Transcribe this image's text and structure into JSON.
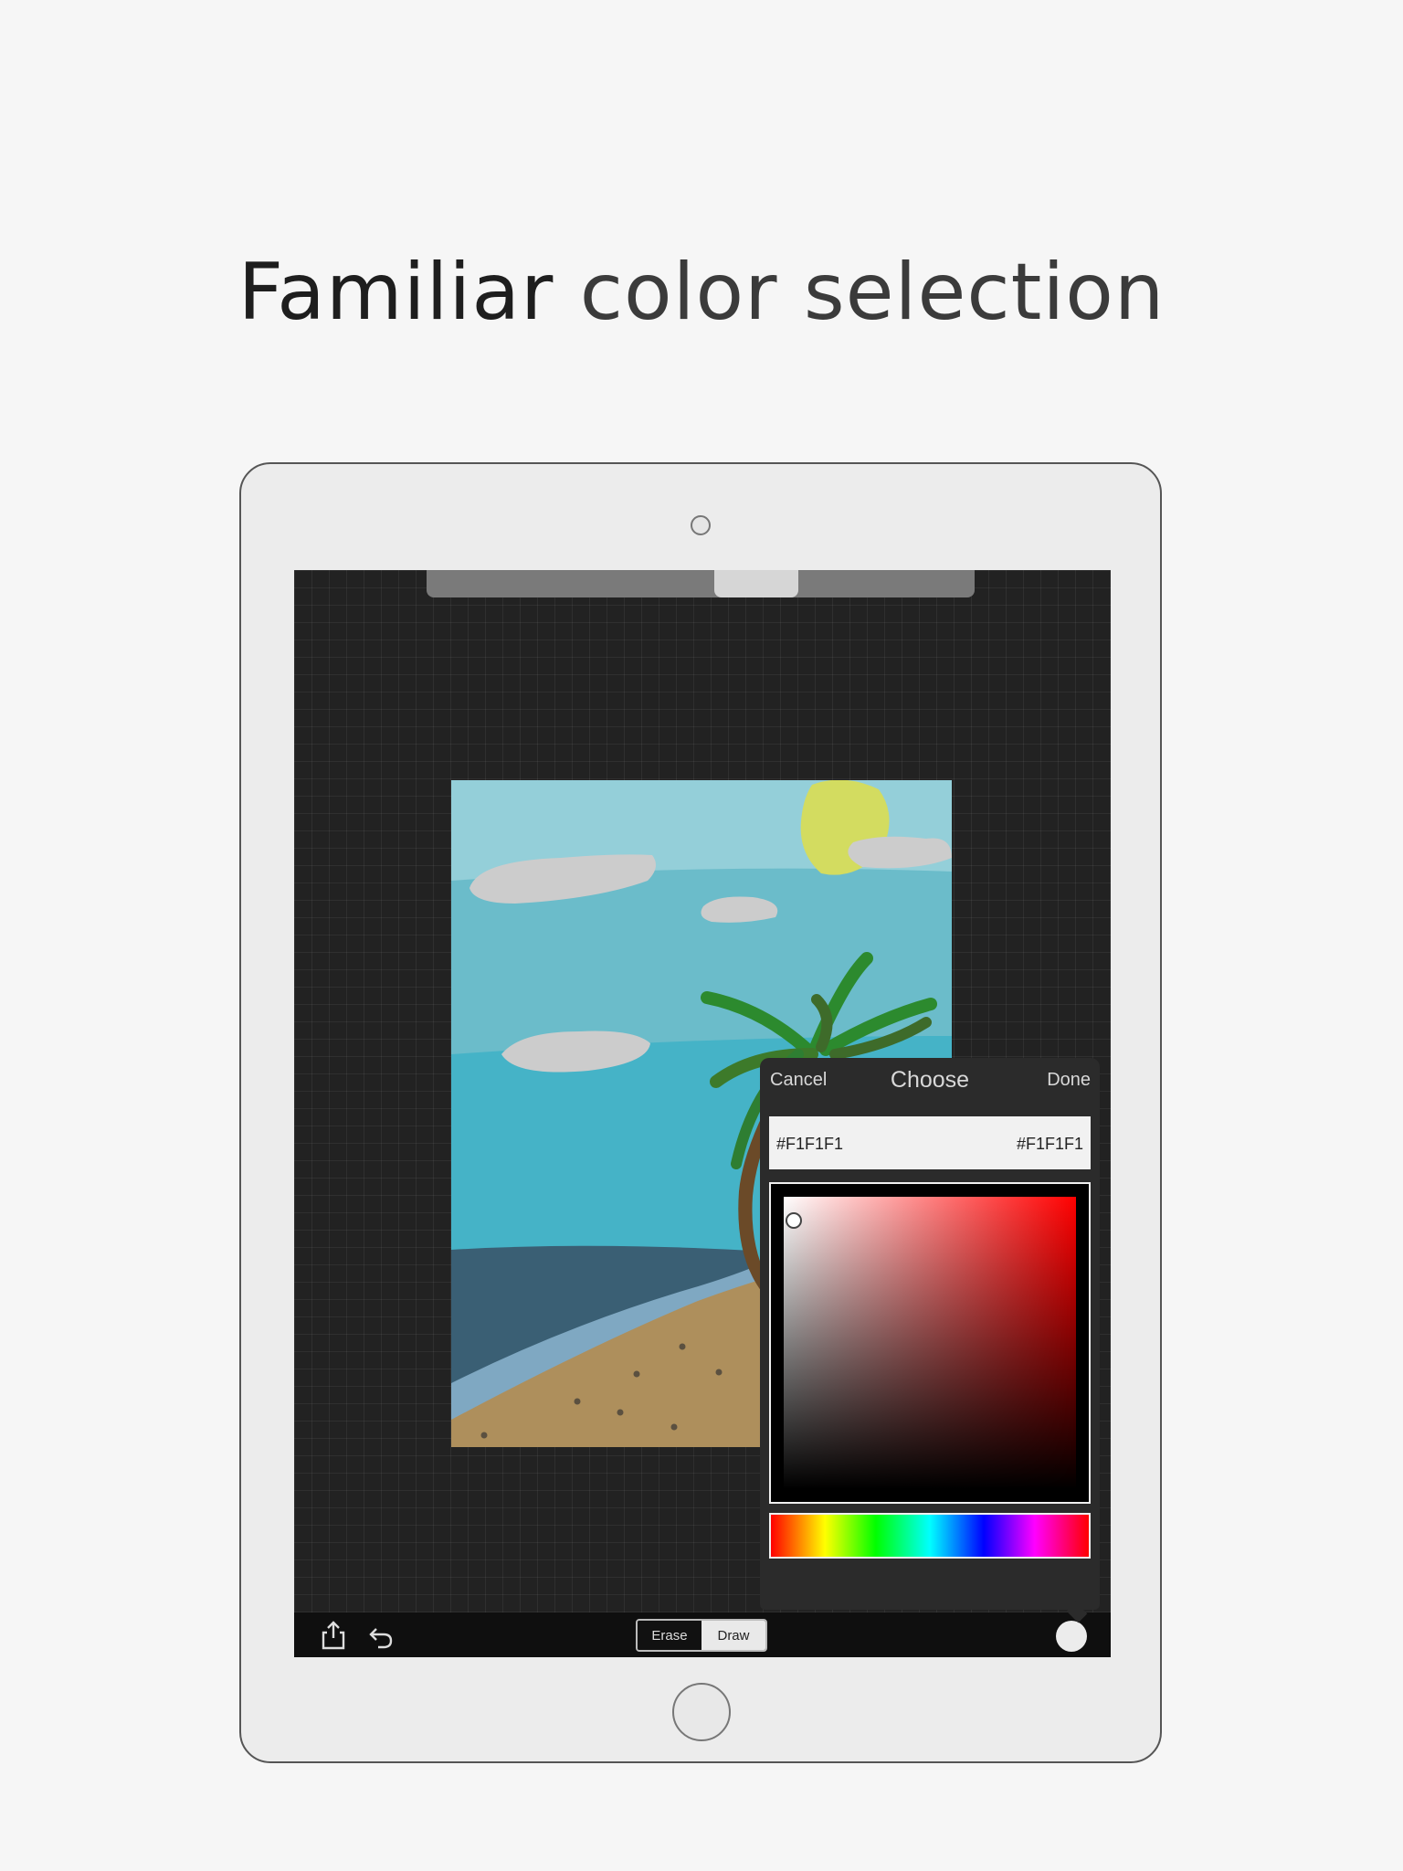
{
  "headline": {
    "part1": "Familiar",
    "part2": "color selection"
  },
  "toolbar": {
    "share_icon": "share-icon",
    "undo_icon": "undo-icon",
    "erase_label": "Erase",
    "draw_label": "Draw",
    "mode_selected": "Draw"
  },
  "color_picker": {
    "cancel_label": "Cancel",
    "title": "Choose",
    "done_label": "Done",
    "previous_hex": "#F1F1F1",
    "current_hex": "#F1F1F1",
    "hue_color": "#FF0000",
    "current_color": "#F1F1F1"
  },
  "colors": {
    "page_background": "#f6f6f6",
    "device_frame": "#ececec",
    "canvas_background": "#222222",
    "popover_background": "#2b2b2b"
  }
}
